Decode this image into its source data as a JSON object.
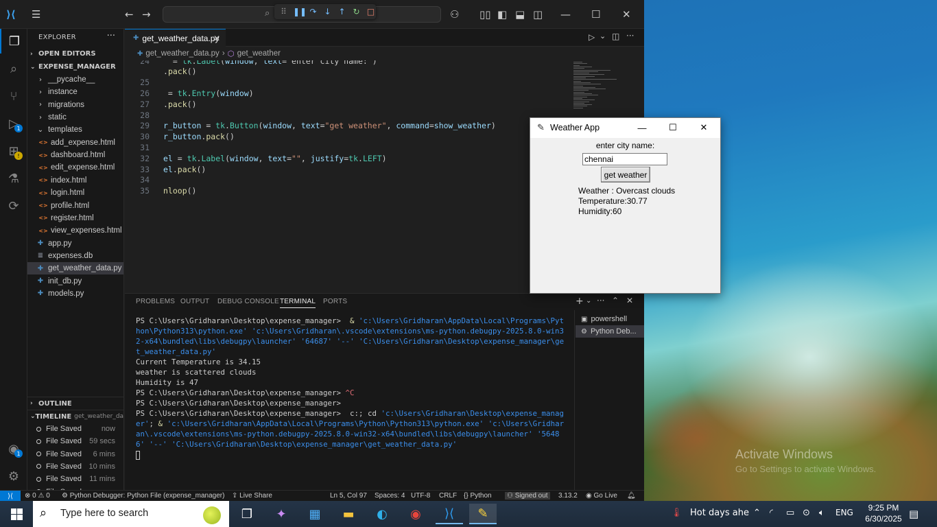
{
  "desktop": {
    "watermark_line1": "Activate Windows",
    "watermark_line2": "Go to Settings to activate Windows."
  },
  "vscode": {
    "explorer_title": "EXPLORER",
    "sections": {
      "open_editors": "OPEN EDITORS",
      "project": "EXPENSE_MANAGER",
      "outline": "OUTLINE",
      "timeline": "TIMELINE",
      "timeline_file": "get_weather_dat..."
    },
    "tree": [
      {
        "label": "__pycache__",
        "type": "folder",
        "depth": 1,
        "open": false
      },
      {
        "label": "instance",
        "type": "folder",
        "depth": 1,
        "open": false
      },
      {
        "label": "migrations",
        "type": "folder",
        "depth": 1,
        "open": false
      },
      {
        "label": "static",
        "type": "folder",
        "depth": 1,
        "open": false
      },
      {
        "label": "templates",
        "type": "folder",
        "depth": 1,
        "open": true
      },
      {
        "label": "add_expense.html",
        "type": "html",
        "depth": 2
      },
      {
        "label": "dashboard.html",
        "type": "html",
        "depth": 2
      },
      {
        "label": "edit_expense.html",
        "type": "html",
        "depth": 2
      },
      {
        "label": "index.html",
        "type": "html",
        "depth": 2
      },
      {
        "label": "login.html",
        "type": "html",
        "depth": 2
      },
      {
        "label": "profile.html",
        "type": "html",
        "depth": 2
      },
      {
        "label": "register.html",
        "type": "html",
        "depth": 2
      },
      {
        "label": "view_expenses.html",
        "type": "html",
        "depth": 2
      },
      {
        "label": "app.py",
        "type": "py",
        "depth": 1
      },
      {
        "label": "expenses.db",
        "type": "db",
        "depth": 1
      },
      {
        "label": "get_weather_data.py",
        "type": "py",
        "depth": 1,
        "selected": true
      },
      {
        "label": "init_db.py",
        "type": "py",
        "depth": 1
      },
      {
        "label": "models.py",
        "type": "py",
        "depth": 1
      }
    ],
    "timeline": [
      {
        "label": "File Saved",
        "time": "now"
      },
      {
        "label": "File Saved",
        "time": "59 secs"
      },
      {
        "label": "File Saved",
        "time": "6 mins"
      },
      {
        "label": "File Saved",
        "time": "10 mins"
      },
      {
        "label": "File Saved",
        "time": "11 mins"
      },
      {
        "label": "File Saved",
        "time": ""
      }
    ],
    "tab": {
      "label": "get_weather_data.py",
      "close": "✕"
    },
    "breadcrumbs": {
      "file": "get_weather_data.py",
      "symbol": "get_weather"
    },
    "code_lines": [
      {
        "n": "24",
        "text": "  = tk.Label(window, text= enter city name: )"
      },
      {
        "n": "",
        "text": ".pack()"
      },
      {
        "n": "25",
        "text": ""
      },
      {
        "n": "26",
        "text": " = tk.Entry(window)"
      },
      {
        "n": "27",
        "text": ".pack()"
      },
      {
        "n": "28",
        "text": ""
      },
      {
        "n": "29",
        "text": "r_button = tk.Button(window, text=\"get weather\", command=show_weather)"
      },
      {
        "n": "30",
        "text": "r_button.pack()"
      },
      {
        "n": "31",
        "text": ""
      },
      {
        "n": "32",
        "text": "el = tk.Label(window, text=\"\", justify=tk.LEFT)"
      },
      {
        "n": "33",
        "text": "el.pack()"
      },
      {
        "n": "34",
        "text": ""
      },
      {
        "n": "35",
        "text": "nloop()"
      }
    ],
    "panel_tabs": [
      "PROBLEMS",
      "OUTPUT",
      "DEBUG CONSOLE",
      "TERMINAL",
      "PORTS"
    ],
    "terminal_lines": [
      "PS C:\\Users\\Gridharan\\Desktop\\expense_manager>  & 'c:\\Users\\Gridharan\\AppData\\Local\\Programs\\Python\\Python313\\python.exe' 'c:\\Users\\Gridharan\\.vscode\\extensions\\ms-python.debugpy-2025.8.0-win32-x64\\bundled\\libs\\debugpy\\launcher' '64687' '--' 'C:\\Users\\Gridharan\\Desktop\\expense_manager\\get_weather_data.py'",
      "Current Temperature is 34.15",
      "weather is scattered clouds",
      "Humidity is 47",
      "PS C:\\Users\\Gridharan\\Desktop\\expense_manager> ^C",
      "PS C:\\Users\\Gridharan\\Desktop\\expense_manager>",
      "PS C:\\Users\\Gridharan\\Desktop\\expense_manager>  c:; cd 'c:\\Users\\Gridharan\\Desktop\\expense_manager'; & 'c:\\Users\\Gridharan\\AppData\\Local\\Programs\\Python\\Python313\\python.exe' 'c:\\Users\\Gridharan\\.vscode\\extensions\\ms-python.debugpy-2025.8.0-win32-x64\\bundled\\libs\\debugpy\\launcher' '56486' '--' 'C:\\Users\\Gridharan\\Desktop\\expense_manager\\get_weather_data.py'"
    ],
    "terminal_list": [
      {
        "label": "powershell",
        "icon": "terminal-icon"
      },
      {
        "label": "Python Deb...",
        "icon": "debug-icon",
        "selected": true
      }
    ],
    "status": {
      "errors": "0",
      "warnings": "0",
      "debug": "Python Debugger: Python File (expense_manager)",
      "live_share": "Live Share",
      "cursor": "Ln 5, Col 97",
      "spaces": "Spaces: 4",
      "encoding": "UTF-8",
      "eol": "CRLF",
      "language": "Python",
      "account": "Signed out",
      "version": "3.13.2",
      "go_live": "Go Live"
    }
  },
  "weather_app": {
    "title": "Weather App",
    "prompt": "enter city name:",
    "city_value": "chennai",
    "button": "get weather",
    "result": "Weather : Overcast clouds\nTemperature:30.77\nHumidity:60"
  },
  "taskbar": {
    "search_placeholder": "Type here to search",
    "weather_text": "Hot days ahe",
    "language": "ENG",
    "time": "9:25 PM",
    "date": "6/30/2025"
  },
  "colors": {
    "vscode_bg": "#1f1f1f",
    "accent": "#0078d4",
    "terminal_string": "#3b8eea"
  }
}
